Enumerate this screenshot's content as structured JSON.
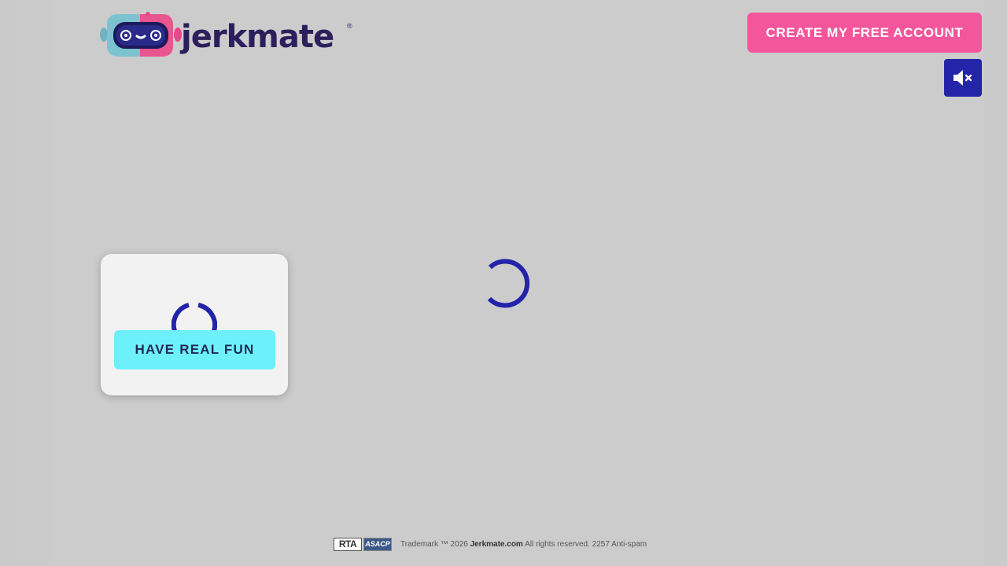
{
  "brand": {
    "name": "jerkmate",
    "registered_mark": "®",
    "text_color": "#2b1f5c",
    "accent_pink": "#f4569b"
  },
  "header": {
    "cta_label": "CREATE MY FREE ACCOUNT",
    "cta_color": "#f4569b",
    "mute_icon": "speaker-muted-icon",
    "mute_color": "#2324a8"
  },
  "main": {
    "loading_icon": "loading-spinner-icon"
  },
  "card": {
    "button_label": "HAVE REAL FUN",
    "button_color": "#6ef0fb",
    "loading_icon": "loading-spinner-icon"
  },
  "footer": {
    "badge_rta": "RTA",
    "badge_asacp": "ASACP",
    "trademark_prefix": "Trademark ™ 2026",
    "site_name": "Jerkmate.com",
    "trademark_suffix": "All rights reserved. 2257 Anti-spam"
  }
}
